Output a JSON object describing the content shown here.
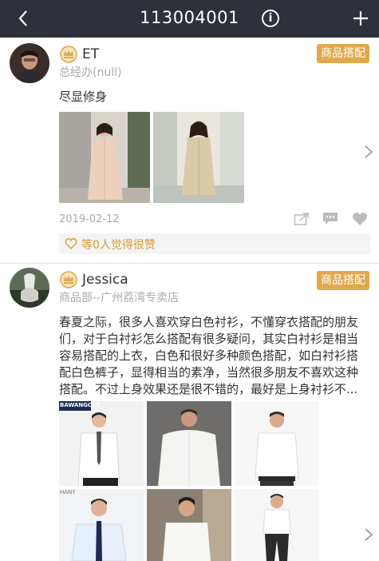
{
  "header": {
    "title": "113004001",
    "info_glyph": "i",
    "icons": [
      "back-icon",
      "info-icon",
      "plus-icon"
    ]
  },
  "posts": [
    {
      "name": "ET",
      "role": "总经办(null)",
      "tag": "商品搭配",
      "text": "尽显修身",
      "date": "2019-02-12",
      "likes": "等0人觉得很赞",
      "image_count": 2
    },
    {
      "name": "Jessica",
      "role": "商品部--广州荔湾专卖店",
      "tag": "商品搭配",
      "text": "春夏之际，很多人喜欢穿白色衬衫，不懂穿衣搭配的朋友们，对于白衬衫怎么搭配有很多疑问，其实白衬衫是相当容易搭配的上衣，白色和很好多种颜色搭配，如白衬衫搭配白色裤子，显得相当的素净，当然很多朋友不喜欢这种搭配。不过上身效果还是很不错的，最好是上身衬衫不...",
      "image_count": 6,
      "image_labels": [
        "BAWANGCHE",
        "HANY"
      ]
    }
  ],
  "colors": {
    "header_bg": "#2e313a",
    "tag_bg": "#e0a94c",
    "like_text": "#d89a35",
    "secondary_text": "#aaaaaa"
  }
}
